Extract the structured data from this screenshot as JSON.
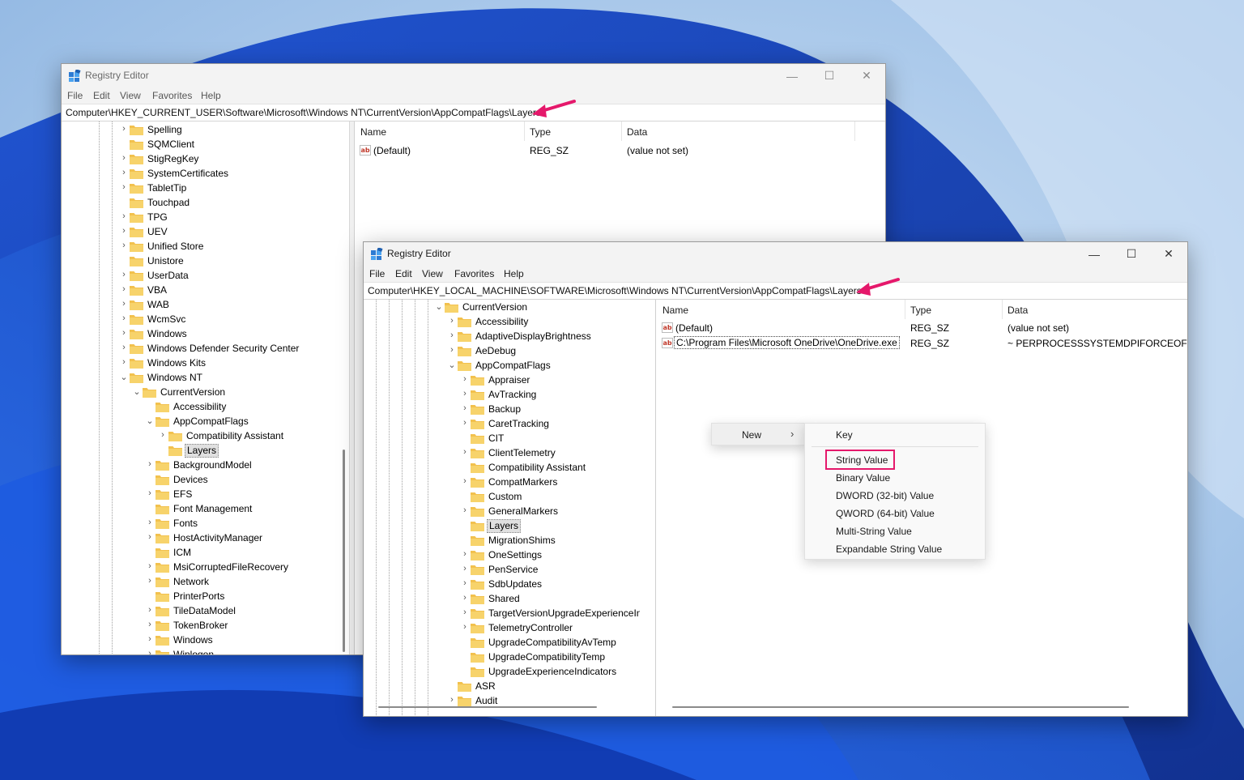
{
  "colors": {
    "accent_arrow": "#e5186b",
    "highlight_box": "#e5186b",
    "wallpaper_base": "#6d9fd8",
    "folder": "#f2c14e"
  },
  "icons": [
    "registry-editor-icon",
    "folder-icon",
    "chevron-right-icon",
    "chevron-down-icon",
    "string-value-icon",
    "minimize-icon",
    "maximize-icon",
    "close-icon",
    "arrow-annotation-icon"
  ],
  "window_back": {
    "title": "Registry Editor",
    "menu": [
      "File",
      "Edit",
      "View",
      "Favorites",
      "Help"
    ],
    "address": "Computer\\HKEY_CURRENT_USER\\Software\\Microsoft\\Windows NT\\CurrentVersion\\AppCompatFlags\\Layers",
    "tree": [
      {
        "label": "Spelling",
        "chev": "›"
      },
      {
        "label": "SQMClient",
        "chev": ""
      },
      {
        "label": "StigRegKey",
        "chev": "›"
      },
      {
        "label": "SystemCertificates",
        "chev": "›"
      },
      {
        "label": "TabletTip",
        "chev": "›"
      },
      {
        "label": "Touchpad",
        "chev": ""
      },
      {
        "label": "TPG",
        "chev": "›"
      },
      {
        "label": "UEV",
        "chev": "›"
      },
      {
        "label": "Unified Store",
        "chev": "›"
      },
      {
        "label": "Unistore",
        "chev": ""
      },
      {
        "label": "UserData",
        "chev": "›"
      },
      {
        "label": "VBA",
        "chev": "›"
      },
      {
        "label": "WAB",
        "chev": "›"
      },
      {
        "label": "WcmSvc",
        "chev": "›"
      },
      {
        "label": "Windows",
        "chev": "›"
      },
      {
        "label": "Windows Defender Security Center",
        "chev": "›"
      },
      {
        "label": "Windows Kits",
        "chev": "›"
      },
      {
        "label": "Windows NT",
        "chev": "⌄"
      },
      {
        "label": "CurrentVersion",
        "chev": "⌄"
      },
      {
        "label": "Accessibility",
        "chev": ""
      },
      {
        "label": "AppCompatFlags",
        "chev": "⌄"
      },
      {
        "label": "Compatibility Assistant",
        "chev": "›"
      },
      {
        "label": "Layers",
        "chev": ""
      },
      {
        "label": "BackgroundModel",
        "chev": "›"
      },
      {
        "label": "Devices",
        "chev": ""
      },
      {
        "label": "EFS",
        "chev": "›"
      },
      {
        "label": "Font Management",
        "chev": ""
      },
      {
        "label": "Fonts",
        "chev": "›"
      },
      {
        "label": "HostActivityManager",
        "chev": "›"
      },
      {
        "label": "ICM",
        "chev": ""
      },
      {
        "label": "MsiCorruptedFileRecovery",
        "chev": "›"
      },
      {
        "label": "Network",
        "chev": "›"
      },
      {
        "label": "PrinterPorts",
        "chev": ""
      },
      {
        "label": "TileDataModel",
        "chev": "›"
      },
      {
        "label": "TokenBroker",
        "chev": "›"
      },
      {
        "label": "Windows",
        "chev": "›"
      },
      {
        "label": "Winlogon",
        "chev": "›"
      }
    ],
    "columns": [
      "Name",
      "Type",
      "Data"
    ],
    "values": [
      {
        "name": "(Default)",
        "type": "REG_SZ",
        "data": "(value not set)"
      }
    ]
  },
  "window_front": {
    "title": "Registry Editor",
    "menu": [
      "File",
      "Edit",
      "View",
      "Favorites",
      "Help"
    ],
    "address": "Computer\\HKEY_LOCAL_MACHINE\\SOFTWARE\\Microsoft\\Windows NT\\CurrentVersion\\AppCompatFlags\\Layers",
    "tree": [
      {
        "label": "CurrentVersion",
        "chev": "⌄"
      },
      {
        "label": "Accessibility",
        "chev": "›"
      },
      {
        "label": "AdaptiveDisplayBrightness",
        "chev": "›"
      },
      {
        "label": "AeDebug",
        "chev": "›"
      },
      {
        "label": "AppCompatFlags",
        "chev": "⌄"
      },
      {
        "label": "Appraiser",
        "chev": "›"
      },
      {
        "label": "AvTracking",
        "chev": "›"
      },
      {
        "label": "Backup",
        "chev": "›"
      },
      {
        "label": "CaretTracking",
        "chev": "›"
      },
      {
        "label": "CIT",
        "chev": ""
      },
      {
        "label": "ClientTelemetry",
        "chev": "›"
      },
      {
        "label": "Compatibility Assistant",
        "chev": ""
      },
      {
        "label": "CompatMarkers",
        "chev": "›"
      },
      {
        "label": "Custom",
        "chev": ""
      },
      {
        "label": "GeneralMarkers",
        "chev": "›"
      },
      {
        "label": "Layers",
        "chev": ""
      },
      {
        "label": "MigrationShims",
        "chev": ""
      },
      {
        "label": "OneSettings",
        "chev": "›"
      },
      {
        "label": "PenService",
        "chev": "›"
      },
      {
        "label": "SdbUpdates",
        "chev": "›"
      },
      {
        "label": "Shared",
        "chev": "›"
      },
      {
        "label": "TargetVersionUpgradeExperienceIndicators",
        "chev": "›"
      },
      {
        "label": "TelemetryController",
        "chev": "›"
      },
      {
        "label": "UpgradeCompatibilityAvTemp",
        "chev": ""
      },
      {
        "label": "UpgradeCompatibilityTemp",
        "chev": ""
      },
      {
        "label": "UpgradeExperienceIndicators",
        "chev": ""
      },
      {
        "label": "ASR",
        "chev": ""
      },
      {
        "label": "Audit",
        "chev": "›"
      }
    ],
    "columns": [
      "Name",
      "Type",
      "Data"
    ],
    "values": [
      {
        "name": "(Default)",
        "type": "REG_SZ",
        "data": "(value not set)"
      },
      {
        "name": "C:\\Program Files\\Microsoft OneDrive\\OneDrive.exe",
        "type": "REG_SZ",
        "data": "~ PERPROCESSSYSTEMDPIFORCEOFF"
      }
    ]
  },
  "context_menu": {
    "new_label": "New",
    "submenu": [
      "Key",
      "String Value",
      "Binary Value",
      "DWORD (32-bit) Value",
      "QWORD (64-bit) Value",
      "Multi-String Value",
      "Expandable String Value"
    ],
    "highlighted": "String Value"
  }
}
